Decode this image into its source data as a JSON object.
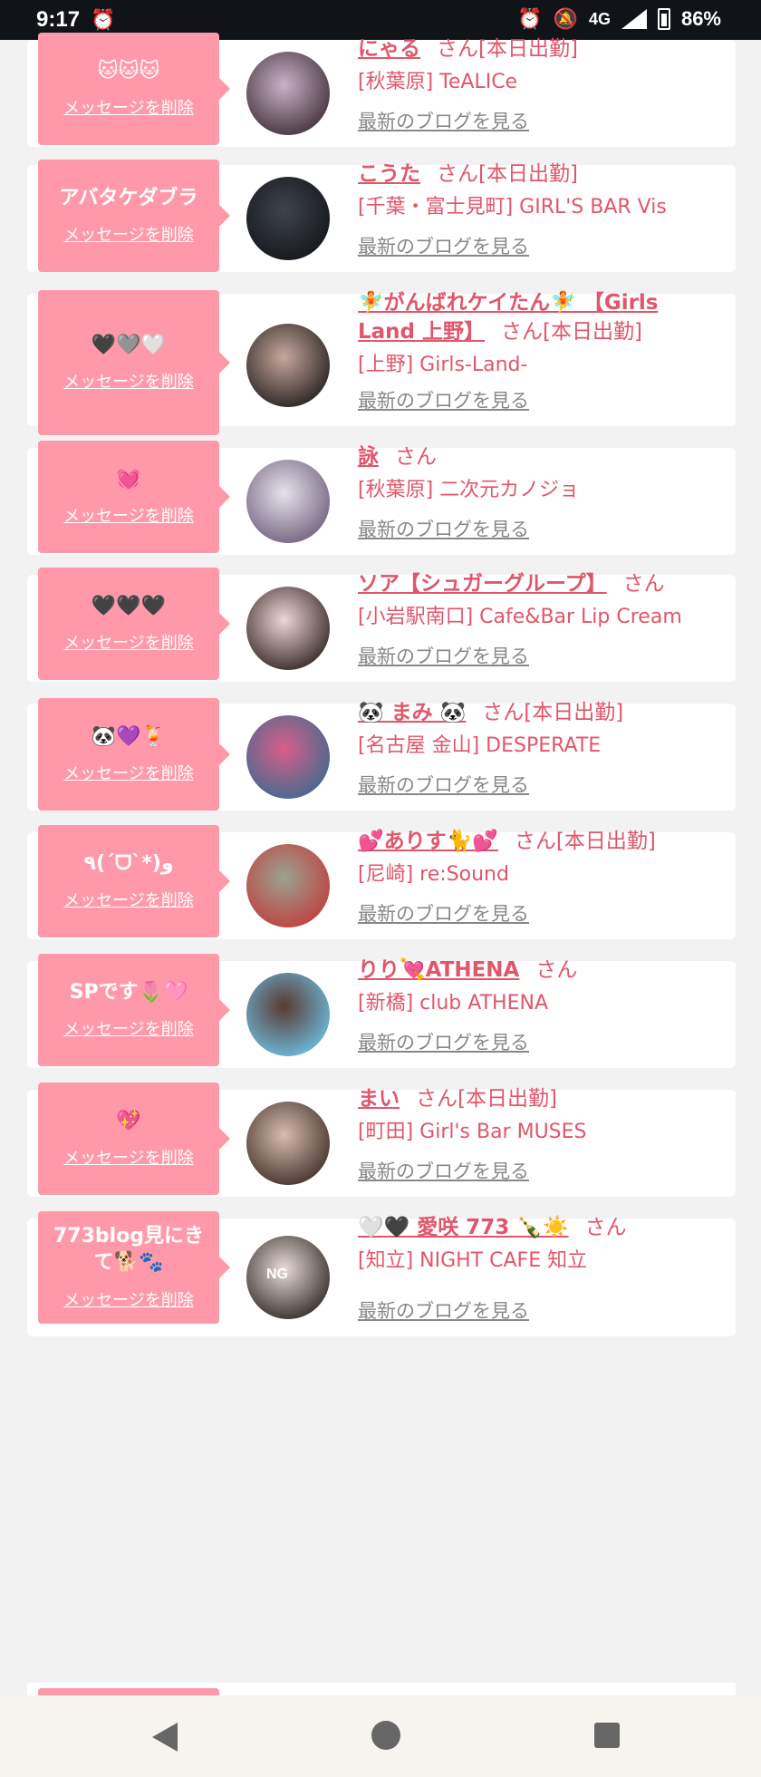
{
  "status_bar": {
    "time": "9:17",
    "network": "4G",
    "battery": "86%",
    "alarm_icon": "alarm-icon",
    "mute_icon": "mute-icon"
  },
  "labels": {
    "delete_message": "メッセージを削除",
    "view_blog": "最新のブログを見る",
    "san": "さん",
    "working_today": "さん[本日出勤]"
  },
  "cards": [
    {
      "msg": "🐱🐱🐱",
      "name": "にゃる",
      "suffix": "さん[本日出勤]",
      "shop": "[秋葉原] TeALICe",
      "avatar_color": [
        "#c9b3c8",
        "#3b2b33"
      ]
    },
    {
      "msg": "アバタケダブラ",
      "name": "こうた",
      "suffix": "さん[本日出勤]",
      "shop": "[千葉・富士見町] GIRL'S BAR Vis",
      "avatar_color": [
        "#3f444c",
        "#121418"
      ]
    },
    {
      "msg": "🖤🩶🤍",
      "name": "🧚がんばれケイたん🧚 【Girls Land 上野】",
      "suffix": "さん[本日出勤]",
      "shop": "[上野] Girls-Land-",
      "avatar_color": [
        "#c7a89c",
        "#1e1a1a"
      ]
    },
    {
      "msg": "💓",
      "name": "詠",
      "suffix": "さん",
      "shop": "[秋葉原] 二次元カノジョ",
      "avatar_color": [
        "#e6e3ea",
        "#6d5b7a"
      ]
    },
    {
      "msg": "🖤🖤🖤",
      "name": "ソア【シュガーグループ】",
      "suffix": "さん",
      "shop": "[小岩駅南口] Cafe&Bar Lip Cream",
      "avatar_color": [
        "#f0d6d6",
        "#2b1f1f"
      ]
    },
    {
      "msg": "🐼💜🍹",
      "name": "🐼 まみ 🐼",
      "suffix": "さん[本日出勤]",
      "shop": "[名古屋 金山] DESPERATE",
      "avatar_color": [
        "#d85f8a",
        "#3a6a8f"
      ]
    },
    {
      "msg": "٩(ˊᗜˋ*)و",
      "name": "💕ありす🐈💕",
      "suffix": "さん[本日出勤]",
      "shop": "[尼崎] re:Sound",
      "avatar_color": [
        "#9aa38f",
        "#c23a3a"
      ]
    },
    {
      "msg": "SPです🌷🩷",
      "name": "りり💘ATHENA",
      "suffix": "さん",
      "shop": "[新橋] club ATHENA",
      "avatar_color": [
        "#5a3a30",
        "#6ec3e8"
      ]
    },
    {
      "msg": "💖",
      "name": "まい",
      "suffix": "さん[本日出勤]",
      "shop": "[町田] Girl's Bar MUSES",
      "avatar_color": [
        "#d8bcae",
        "#3a2a24"
      ]
    },
    {
      "msg": "773blog見にきて🐕🐾",
      "name": "🤍🖤 愛咲 773 🍾☀️",
      "suffix": "さん",
      "shop": "[知立] NIGHT CAFE 知立",
      "avatar_color": [
        "#e8ddd6",
        "#2a2220"
      ]
    }
  ],
  "avatar_badges": {
    "card_10": "NG"
  }
}
